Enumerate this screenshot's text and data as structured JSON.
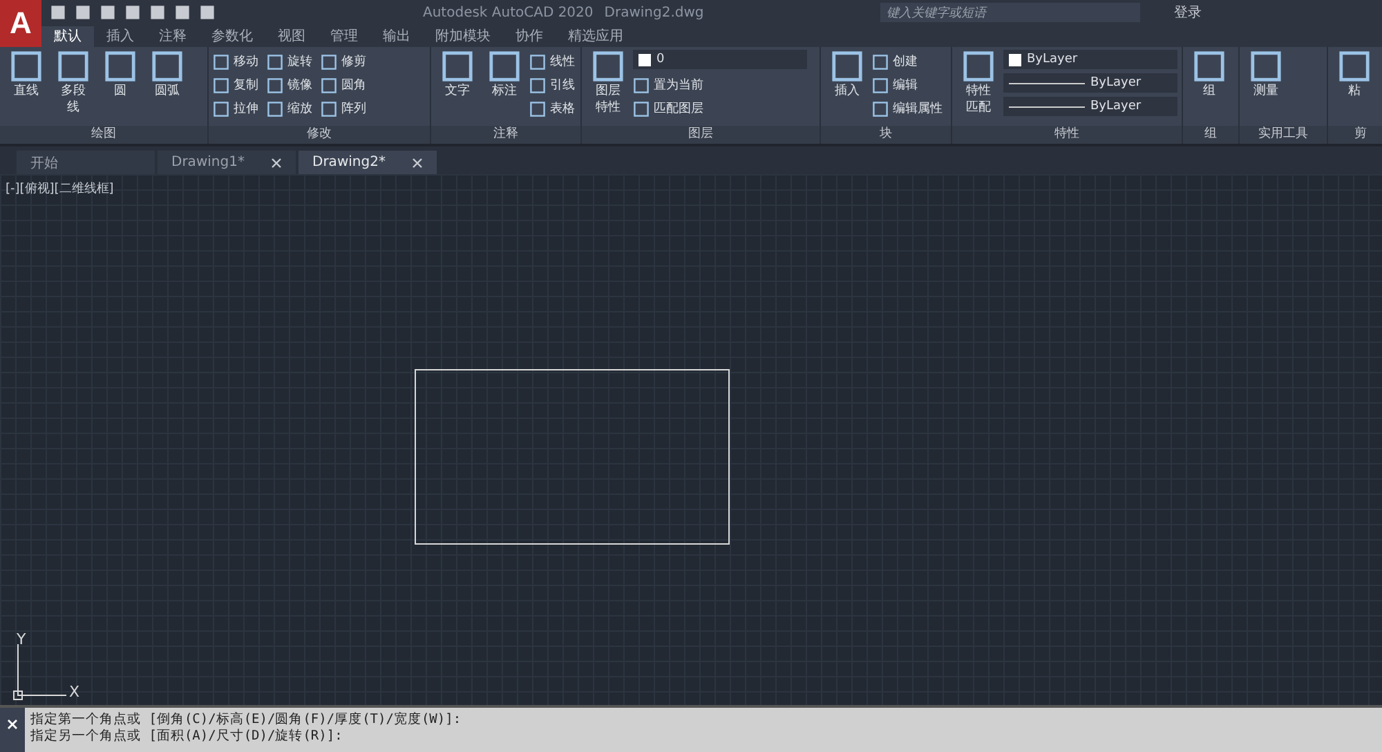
{
  "title_bar": {
    "logo": "A",
    "app_title": "Autodesk AutoCAD 2020",
    "file_name": "Drawing2.dwg",
    "search": {
      "placeholder": "键入关键字或短语"
    },
    "login": "登录"
  },
  "ribbon_tabs": [
    {
      "label": "默认",
      "selected": true
    },
    {
      "label": "插入",
      "selected": false
    },
    {
      "label": "注释",
      "selected": false
    },
    {
      "label": "参数化",
      "selected": false
    },
    {
      "label": "视图",
      "selected": false
    },
    {
      "label": "管理",
      "selected": false
    },
    {
      "label": "输出",
      "selected": false
    },
    {
      "label": "附加模块",
      "selected": false
    },
    {
      "label": "协作",
      "selected": false
    },
    {
      "label": "精选应用",
      "selected": false
    }
  ],
  "panels": [
    {
      "title": "绘图",
      "items": [
        {
          "kind": "large",
          "label": "直线"
        },
        {
          "kind": "large",
          "label": "多段线"
        },
        {
          "kind": "large",
          "label": "圆"
        },
        {
          "kind": "large",
          "label": "圆弧"
        }
      ]
    },
    {
      "title": "修改",
      "items": [
        {
          "kind": "small",
          "label": "移动"
        },
        {
          "kind": "small",
          "label": "复制"
        },
        {
          "kind": "small",
          "label": "拉伸"
        },
        {
          "kind": "small",
          "label": "旋转"
        },
        {
          "kind": "small",
          "label": "镜像"
        },
        {
          "kind": "small",
          "label": "缩放"
        },
        {
          "kind": "small",
          "label": "修剪"
        },
        {
          "kind": "small",
          "label": "圆角"
        },
        {
          "kind": "small",
          "label": "阵列"
        }
      ]
    },
    {
      "title": "注释",
      "items": [
        {
          "kind": "large",
          "label": "文字"
        },
        {
          "kind": "large",
          "label": "标注"
        },
        {
          "kind": "small",
          "label": "线性"
        },
        {
          "kind": "small",
          "label": "引线"
        },
        {
          "kind": "small",
          "label": "表格"
        }
      ]
    },
    {
      "title": "图层",
      "items": [
        {
          "kind": "large",
          "label": "图层特性"
        },
        {
          "kind": "dropdown",
          "label": "0"
        },
        {
          "kind": "small",
          "label": "置为当前"
        },
        {
          "kind": "small",
          "label": "匹配图层"
        }
      ]
    },
    {
      "title": "块",
      "items": [
        {
          "kind": "large",
          "label": "插入"
        },
        {
          "kind": "small",
          "label": "创建"
        },
        {
          "kind": "small",
          "label": "编辑"
        },
        {
          "kind": "small",
          "label": "编辑属性"
        }
      ]
    },
    {
      "title": "特性",
      "items": [
        {
          "kind": "large",
          "label": "特性匹配"
        },
        {
          "kind": "dropdown",
          "label": "ByLayer"
        },
        {
          "kind": "dropdown",
          "label": "ByLayer"
        },
        {
          "kind": "dropdown",
          "label": "ByLayer"
        }
      ]
    },
    {
      "title": "组",
      "items": [
        {
          "kind": "large",
          "label": "组"
        }
      ]
    },
    {
      "title": "实用工具",
      "items": [
        {
          "kind": "large",
          "label": "测量"
        }
      ]
    },
    {
      "title": "剪",
      "items": [
        {
          "kind": "large",
          "label": "粘"
        }
      ]
    }
  ],
  "doc_tabs": [
    {
      "label": "开始",
      "selected": false
    },
    {
      "label": "Drawing1*",
      "selected": false
    },
    {
      "label": "Drawing2*",
      "selected": true
    }
  ],
  "viewport": {
    "label": "[-][俯视][二维线框]",
    "axis_y": "Y",
    "axis_x": "X"
  },
  "command_lines": [
    "指定第一个角点或 [倒角(C)/标高(E)/圆角(F)/厚度(T)/宽度(W)]:",
    "指定另一个角点或 [面积(A)/尺寸(D)/旋转(R)]:"
  ]
}
